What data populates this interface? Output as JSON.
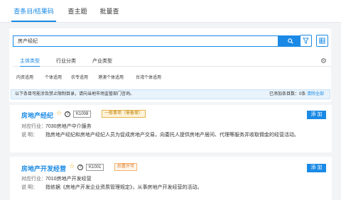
{
  "tabs": [
    {
      "label": "查条目/结果码"
    },
    {
      "label": "查主题"
    },
    {
      "label": "批量查"
    }
  ],
  "search": {
    "value": "房产经纪"
  },
  "subtabs": [
    {
      "label": "主体类型"
    },
    {
      "label": "行业分类"
    },
    {
      "label": "产业类型"
    }
  ],
  "chips": [
    "内资适用",
    "个体适用",
    "农专适用",
    "港澳个体适用",
    "台湾个体适用"
  ],
  "notice": {
    "text": "以下条目可能涉及禁止限制目录，请向当地市场监管部门咨询。",
    "selected": "已添加条目数：0条",
    "clear": "清除全部"
  },
  "results": [
    {
      "title": "房地产经纪",
      "code": "K1008",
      "tag": "一般事项（需备案）",
      "add_label": "添 加",
      "industry_key": "对应行业：",
      "industry_value": "7030房地产中介服务",
      "desc_key": "说      明：",
      "desc_value": "指房地产经纪和房地产经纪人员为促成房地产交易，向委托人提供房地产居间、代理等服务并收取佣金的经营活动。"
    },
    {
      "title": "房地产开发经营",
      "code": "K1001",
      "tag": "后置许可",
      "add_label": "添 加",
      "industry_key": "对应行业：",
      "industry_value": "7010房地产开发经营",
      "desc_key": "说      明：",
      "desc_value": "指依据《房地产开发企业资质管理规定》，从事房地产开发经营的活动。"
    }
  ],
  "colors": {
    "accent": "#1a8ae6",
    "warn": "#e0751a",
    "star": "#e8a000"
  }
}
